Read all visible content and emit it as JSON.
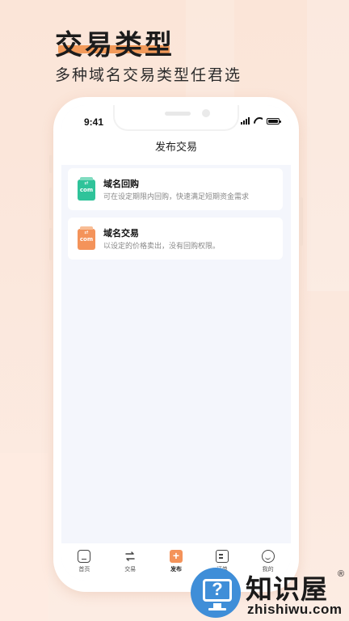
{
  "promo": {
    "headline": "交易类型",
    "subline": "多种域名交易类型任君选"
  },
  "status_bar": {
    "time": "9:41"
  },
  "nav": {
    "title": "发布交易"
  },
  "options": [
    {
      "icon": "com-domain-green-icon",
      "icon_text": "com",
      "title": "域名回购",
      "description": "可在设定期限内回购，快速满足短期资金需求"
    },
    {
      "icon": "com-domain-orange-icon",
      "icon_text": "com",
      "title": "域名交易",
      "description": "以设定的价格卖出，没有回购权限。"
    }
  ],
  "tabbar": {
    "items": [
      {
        "label": "首页",
        "icon": "home-icon"
      },
      {
        "label": "交易",
        "icon": "exchange-icon"
      },
      {
        "label": "发布",
        "icon": "plus-icon",
        "active": true
      },
      {
        "label": "订单",
        "icon": "document-icon"
      },
      {
        "label": "我的",
        "icon": "smile-face-icon"
      }
    ]
  },
  "watermark": {
    "title": "知识屋",
    "reg": "®",
    "url": "zhishiwu.com"
  },
  "colors": {
    "accent_orange": "#f4935a",
    "accent_green": "#2fc39a",
    "watermark_blue": "#3f8ed8"
  }
}
